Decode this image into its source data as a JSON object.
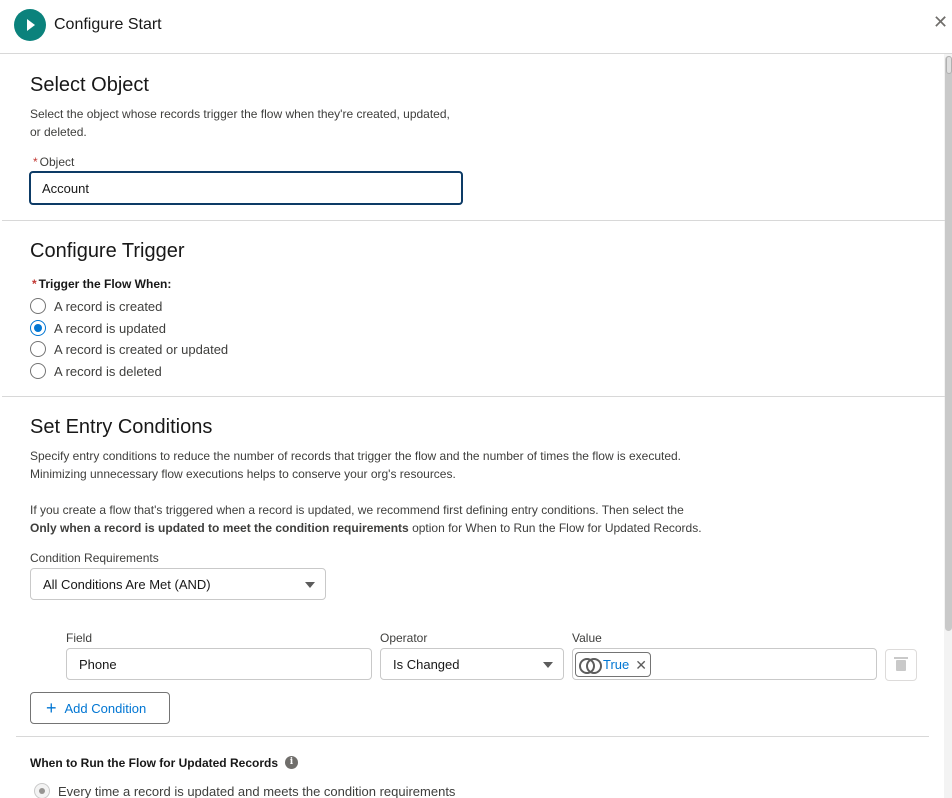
{
  "header": {
    "title": "Configure Start",
    "start_icon": "play-icon",
    "close_icon": "close-icon",
    "close_glyph": "✕"
  },
  "select_object": {
    "heading": "Select Object",
    "description": "Select the object whose records trigger the flow when they're created, updated, or deleted.",
    "required_mark": "*",
    "object_label": "Object",
    "object_value": "Account"
  },
  "configure_trigger": {
    "heading": "Configure Trigger",
    "required_mark": "*",
    "trigger_label": "Trigger the Flow When:",
    "options": [
      {
        "label": "A record is created",
        "selected": false
      },
      {
        "label": "A record is updated",
        "selected": true
      },
      {
        "label": "A record is created or updated",
        "selected": false
      },
      {
        "label": "A record is deleted",
        "selected": false
      }
    ]
  },
  "entry_conditions": {
    "heading": "Set Entry Conditions",
    "desc_line1": "Specify entry conditions to reduce the number of records that trigger the flow and the number of times the flow is executed.",
    "desc_line2": "Minimizing unnecessary flow executions helps to conserve your org's resources.",
    "desc_line3": "If you create a flow that's triggered when a record is updated, we recommend first defining entry conditions. Then select the",
    "desc_bold": "Only when a record is updated to meet the condition requirements",
    "desc_line4_rest": " option for When to Run the Flow for Updated Records.",
    "condition_requirements_label": "Condition Requirements",
    "condition_requirements_value": "All Conditions Are Met (AND)",
    "field_label": "Field",
    "operator_label": "Operator",
    "value_label": "Value",
    "field_value": "Phone",
    "operator_value": "Is Changed",
    "value_pill": "True",
    "pill_remove_glyph": "✕",
    "add_condition_label": "Add Condition",
    "add_glyph": "+"
  },
  "when_to_run": {
    "heading": "When to Run the Flow for Updated Records",
    "info_glyph": "i",
    "option1": "Every time a record is updated and meets the condition requirements"
  },
  "colors": {
    "accent": "#0176d3",
    "start_icon_bg": "#0b827c",
    "focus_border": "#0d3b66",
    "required": "#c23934"
  }
}
